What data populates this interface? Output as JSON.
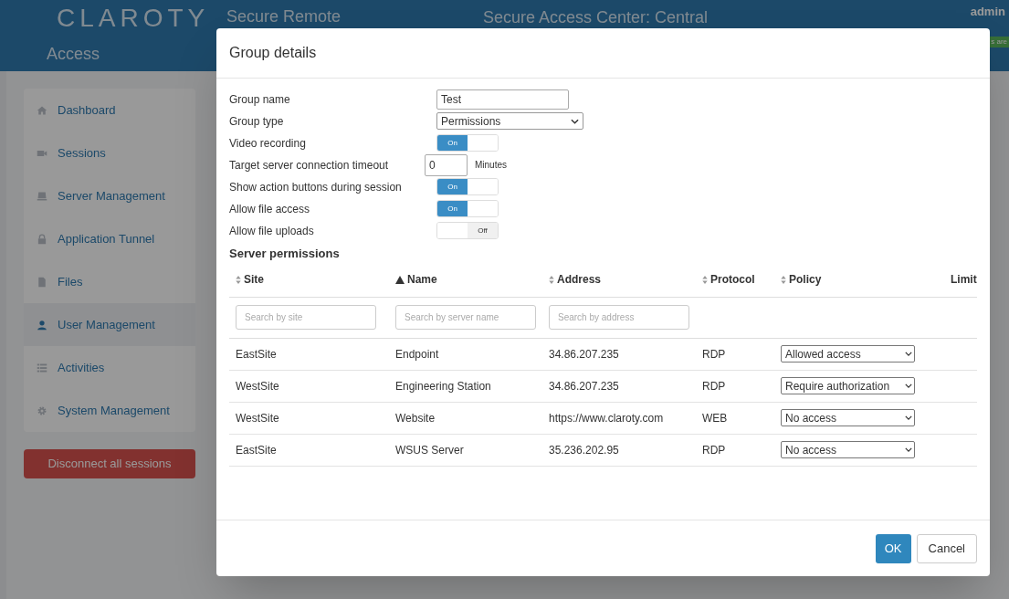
{
  "header": {
    "logo": "CLAROTY",
    "app_title_line1": "Secure Remote",
    "app_title_line2": "Access",
    "center_title": "Secure Access Center: Central",
    "user": "admin",
    "badge": "s are"
  },
  "sidebar": {
    "items": [
      {
        "label": "Dashboard",
        "selected": false
      },
      {
        "label": "Sessions",
        "selected": false
      },
      {
        "label": "Server Management",
        "selected": false
      },
      {
        "label": "Application Tunnel",
        "selected": false
      },
      {
        "label": "Files",
        "selected": false
      },
      {
        "label": "User Management",
        "selected": true
      },
      {
        "label": "Activities",
        "selected": false
      },
      {
        "label": "System Management",
        "selected": false
      }
    ],
    "disconnect_button": "Disconnect all sessions"
  },
  "dialog": {
    "title": "Group details",
    "fields": [
      {
        "kind": "text",
        "label": "Group name",
        "value": "Test"
      },
      {
        "kind": "select",
        "label": "Group type",
        "value": "Permissions"
      },
      {
        "kind": "toggle",
        "label": "Video recording",
        "on": true,
        "state_label": "On"
      },
      {
        "kind": "number",
        "label": "Target server connection timeout",
        "value": "0",
        "unit": "Minutes"
      },
      {
        "kind": "toggle",
        "label": "Show action buttons during session",
        "on": true,
        "state_label": "On"
      },
      {
        "kind": "toggle",
        "label": "Allow file access",
        "on": true,
        "state_label": "On"
      },
      {
        "kind": "toggle",
        "label": "Allow file uploads",
        "on": false,
        "state_label": "Off"
      }
    ],
    "section_title": "Server permissions",
    "table": {
      "columns": [
        {
          "kind": "sortable",
          "label": "Site",
          "filter_placeholder": "Search by site"
        },
        {
          "kind": "sorted",
          "label": "Name",
          "filter_placeholder": "Search by server name"
        },
        {
          "kind": "sortable",
          "label": "Address",
          "filter_placeholder": "Search by address"
        },
        {
          "kind": "sortable",
          "label": "Protocol"
        },
        {
          "kind": "sortable",
          "label": "Policy"
        },
        {
          "kind": "plain",
          "label": "Limit"
        }
      ],
      "rows": [
        {
          "site": "EastSite",
          "name": "Endpoint",
          "address": "34.86.207.235",
          "protocol": "RDP",
          "policy": "Allowed access"
        },
        {
          "site": "WestSite",
          "name": "Engineering Station",
          "address": "34.86.207.235",
          "protocol": "RDP",
          "policy": "Require authorization"
        },
        {
          "site": "WestSite",
          "name": "Website",
          "address": "https://www.claroty.com",
          "protocol": "WEB",
          "policy": "No access"
        },
        {
          "site": "EastSite",
          "name": "WSUS Server",
          "address": "35.236.202.95",
          "protocol": "RDP",
          "policy": "No access"
        }
      ]
    },
    "buttons": [
      {
        "kind": "primary",
        "label": "OK"
      },
      {
        "kind": "secondary",
        "label": "Cancel"
      }
    ]
  }
}
